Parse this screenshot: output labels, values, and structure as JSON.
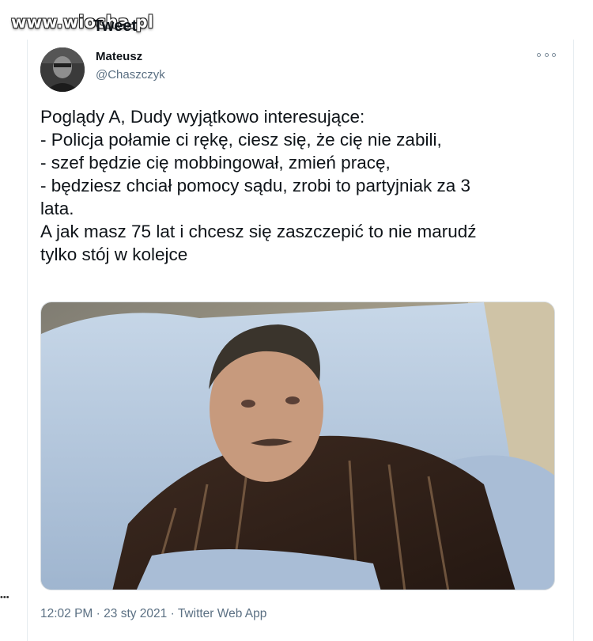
{
  "watermark": "www.wiocha.pl",
  "page_header": {
    "partial_title": "Tweet"
  },
  "author": {
    "display_name": "Mateusz",
    "handle": "@Chaszczyk"
  },
  "tweet": {
    "lines": [
      "Poglądy A, Dudy wyjątkowo interesujące:",
      "- Policja połamie ci rękę, ciesz się, że cię nie zabili,",
      "- szef będzie cię mobbingował, zmień pracę,",
      "- będziesz chciał pomocy sądu, zrobi to partyjniak za 3",
      "lata.",
      "A jak masz 75 lat i chcesz się zaszczepić to nie marudź",
      "tylko stój w kolejce"
    ],
    "time": "12:02 PM",
    "date": "23 sty 2021",
    "source": "Twitter Web App"
  },
  "icons": {
    "more": "more-options-icon"
  },
  "colors": {
    "text_primary": "#0f1419",
    "text_secondary": "#5b7083",
    "border": "#e6ecf0"
  }
}
